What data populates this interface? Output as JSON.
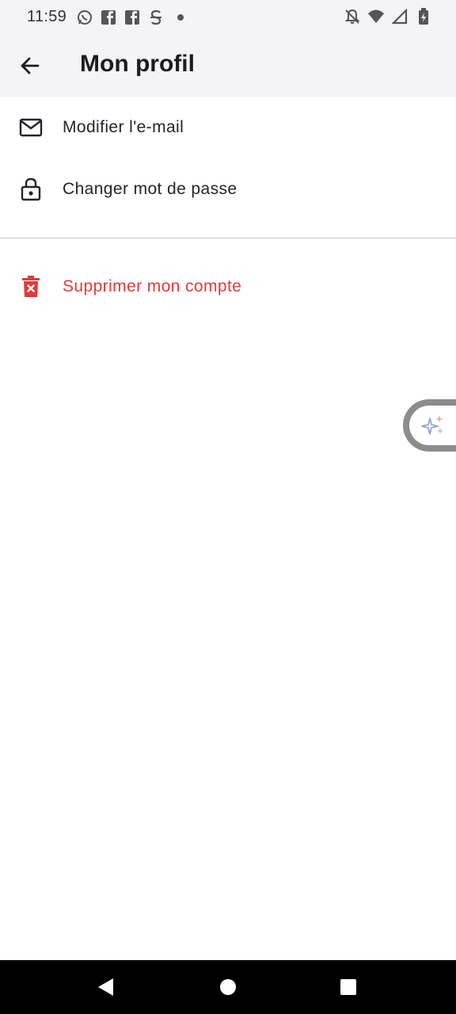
{
  "status_bar": {
    "time": "11:59",
    "left_icons": [
      "whatsapp-icon",
      "facebook-icon",
      "facebook-icon",
      "s-app-icon",
      "notification-dot"
    ],
    "right_icons": [
      "bell-off-icon",
      "wifi-icon",
      "signal-icon",
      "battery-icon"
    ]
  },
  "app_bar": {
    "title": "Mon profil",
    "back_icon": "arrow-left-icon"
  },
  "menu": {
    "items": [
      {
        "label": "Modifier l'e-mail",
        "icon": "mail-icon"
      },
      {
        "label": "Changer mot de passe",
        "icon": "lock-icon"
      }
    ],
    "danger_item": {
      "label": "Supprimer mon compte",
      "icon": "trash-icon",
      "color": "#e23a3a"
    }
  },
  "floating_button": {
    "icon": "sparkle-icon"
  },
  "nav_bar": {
    "buttons": [
      "back-triangle-icon",
      "home-circle-icon",
      "recents-square-icon"
    ]
  },
  "colors": {
    "surface": "#f4f3f8",
    "danger": "#e23a3a",
    "text": "#24242a"
  }
}
